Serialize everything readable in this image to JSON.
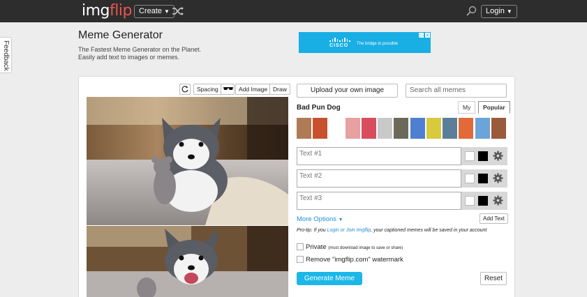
{
  "nav": {
    "logo_a": "img",
    "logo_b": "flip",
    "create_label": "Create",
    "login_label": "Login"
  },
  "feedback_label": "Feedback",
  "header": {
    "title": "Meme Generator",
    "subtitle": "The Fastest Meme Generator on the Planet. Easily add text to images or memes."
  },
  "ad": {
    "brand": "CISCO",
    "tagline": "The bridge to possible"
  },
  "toolbar": {
    "spacing_label": "Spacing",
    "add_image_label": "Add Image",
    "draw_label": "Draw"
  },
  "controls": {
    "upload_label": "Upload your own image",
    "search_placeholder": "Search all memes",
    "meme_name": "Bad Pun Dog",
    "tab_my": "My",
    "tab_popular": "Popular",
    "text_placeholders": [
      "Text #1",
      "Text #2",
      "Text #3"
    ],
    "more_options_label": "More Options",
    "add_text_label": "Add Text",
    "protip_prefix": "Pro-tip: If you ",
    "protip_link": "Login or Join Imgflip",
    "protip_suffix": ", your captioned memes will be saved in your account",
    "private_label": "Private",
    "private_note": "(must download image to save or share)",
    "watermark_label": "Remove \"imgflip.com\" watermark",
    "generate_label": "Generate Meme",
    "reset_label": "Reset"
  },
  "thumb_colors": [
    "#b07a55",
    "#c8502d",
    "#ffffff",
    "#e8a1a0",
    "#d94d5c",
    "#c9c9c9",
    "#6b6a5a",
    "#4f7fd0",
    "#d8c93e",
    "#5b7f98",
    "#e06a39",
    "#6aa4d8",
    "#9a5a3c"
  ]
}
